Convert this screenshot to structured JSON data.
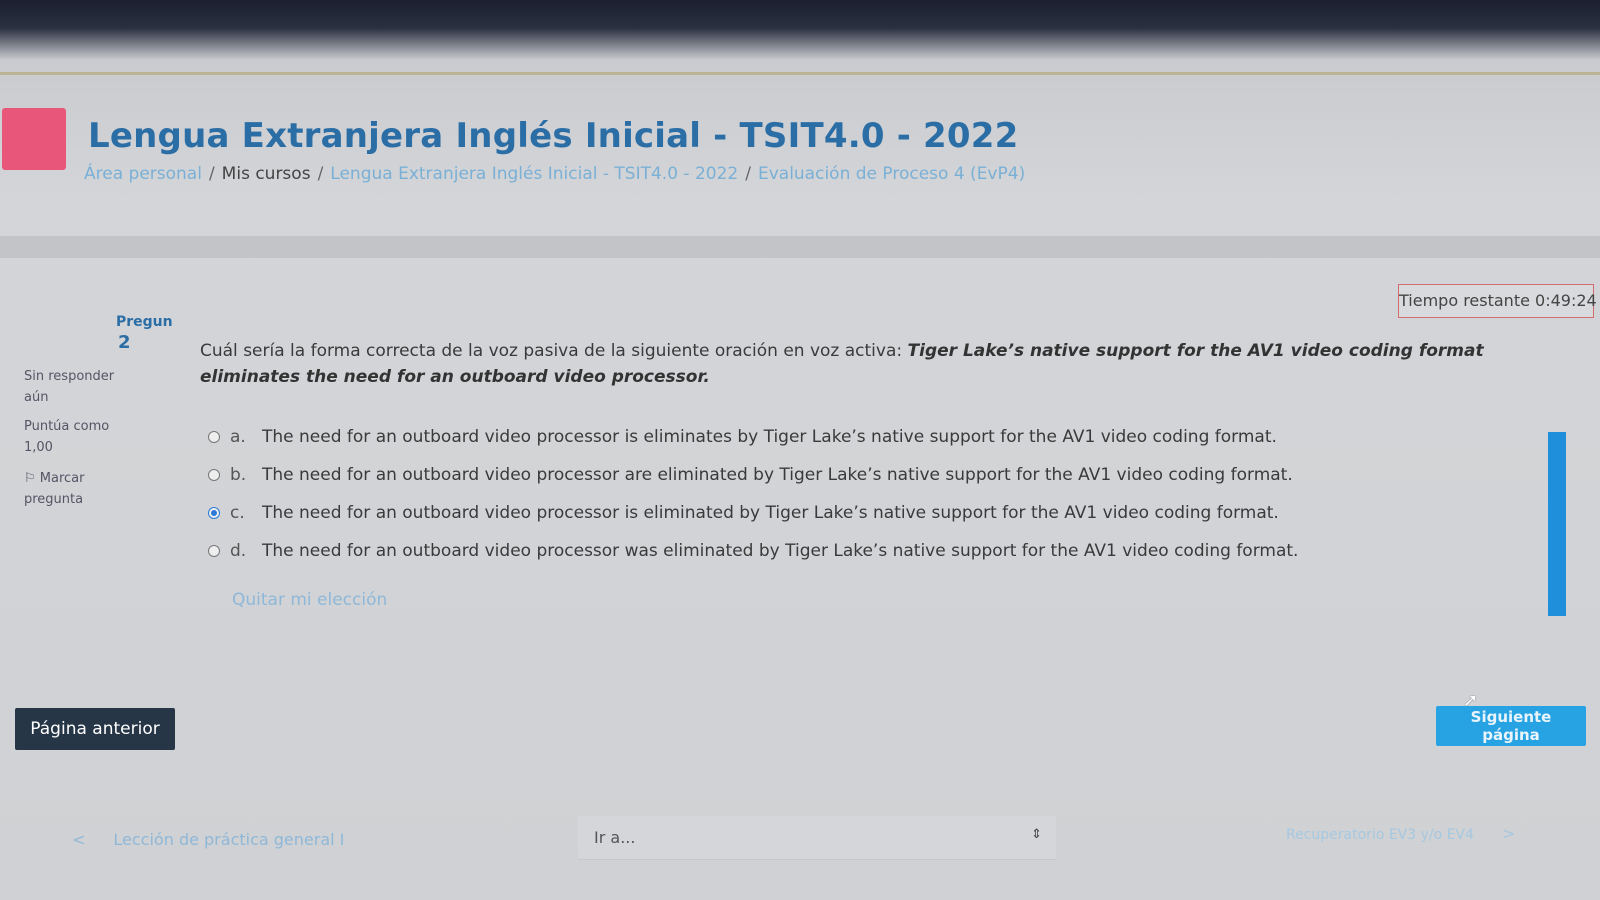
{
  "course": {
    "title": "Lengua Extranjera Inglés Inicial - TSIT4.0 - 2022"
  },
  "breadcrumb": {
    "items": [
      "Área personal",
      "Mis cursos",
      "Lengua Extranjera Inglés Inicial - TSIT4.0 - 2022",
      "Evaluación de Proceso 4 (EvP4)"
    ],
    "separator": "/"
  },
  "timer": {
    "label": "Tiempo restante 0:49:24"
  },
  "question_info": {
    "label": "Pregun",
    "number": "2",
    "state": "Sin responder aún",
    "grade": "Puntúa como 1,00",
    "flag_label": "Marcar pregunta",
    "flag_icon": "flag-icon"
  },
  "question": {
    "prompt": "Cuál sería la forma correcta de la voz pasiva de la siguiente oración en voz activa: ",
    "sentence": "Tiger Lake’s native support for the AV1 video coding format eliminates the need for an outboard video processor."
  },
  "answers": [
    {
      "letter": "a.",
      "text": "The need for an outboard video processor is eliminates by Tiger Lake’s native support for the AV1 video coding format.",
      "selected": false
    },
    {
      "letter": "b.",
      "text": "The need for an outboard video processor are eliminated by Tiger Lake’s native support for the AV1 video coding format.",
      "selected": false
    },
    {
      "letter": "c.",
      "text": "The need for an outboard video processor is eliminated by Tiger Lake’s native support for the AV1 video coding format.",
      "selected": true
    },
    {
      "letter": "d.",
      "text": "The need for an outboard video processor was eliminated by Tiger Lake’s native support for the AV1 video coding format.",
      "selected": false
    }
  ],
  "clear_choice": "Quitar mi elección",
  "buttons": {
    "previous": "Página anterior",
    "next": "Siguiente página"
  },
  "footer_nav": {
    "prev_link": "Lección de práctica general I",
    "prev_chevron": "<",
    "jump_placeholder": "Ir a...",
    "jump_arrow": "⇕",
    "next_link": "Recuperatorio EV3 y/o EV4",
    "next_chevron": ">"
  },
  "colors": {
    "brand_blue": "#2b6ea6",
    "link_blue": "#7ab0d6",
    "next_button": "#27a3e4",
    "prev_button": "#263646",
    "course_icon": "#e8567a",
    "timer_border": "#d36c6c"
  }
}
